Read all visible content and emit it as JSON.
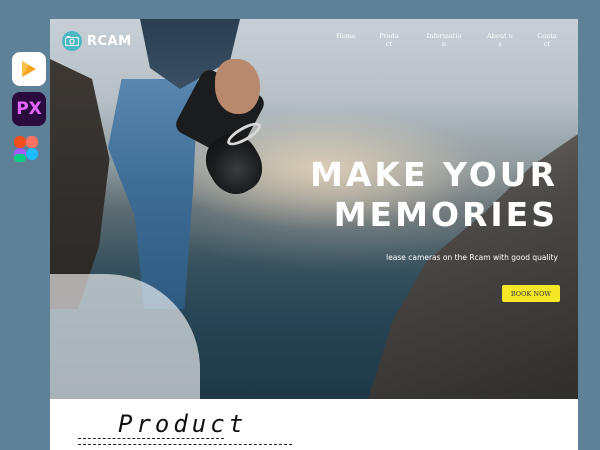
{
  "app_icons": [
    {
      "name": "infinity-app-icon",
      "glyph": ""
    },
    {
      "name": "px-app-icon",
      "glyph": "PX"
    },
    {
      "name": "figma-app-icon",
      "glyph": ""
    }
  ],
  "site": {
    "logo_text": "RCAM",
    "nav": [
      "Home",
      "Product",
      "Information",
      "About us",
      "Contact"
    ],
    "hero": {
      "headline_line1": "MAKE YOUR",
      "headline_line2": "MEMORIES",
      "subline": "lease cameras on the Rcam with good quality",
      "cta_label": "BOOK NOW"
    },
    "product_section": {
      "title": "Product"
    }
  },
  "colors": {
    "background": "#5e8198",
    "accent_cta": "#f5e628",
    "logo_mark": "#4fb7c4"
  }
}
